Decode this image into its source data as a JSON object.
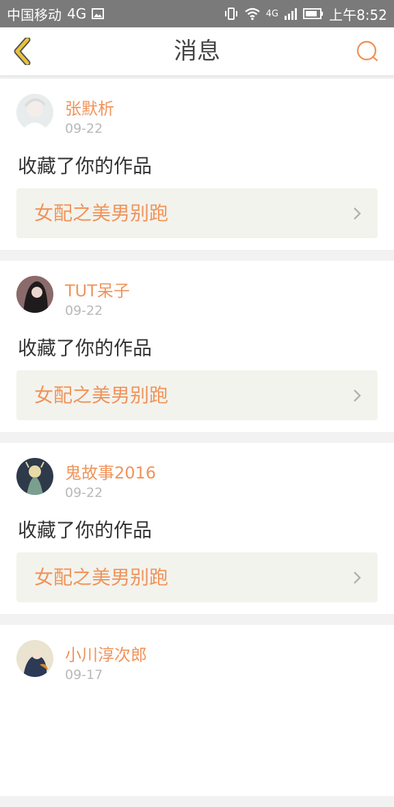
{
  "status_bar": {
    "carrier": "中国移动",
    "network": "4G",
    "network_small": "4G",
    "time": "上午8:52"
  },
  "header": {
    "title": "消息",
    "back_icon": "chevron-left-icon",
    "search_icon": "search-icon"
  },
  "colors": {
    "accent": "#f0935a",
    "back_icon": "#e8c33a",
    "card_bg": "#f3f3ed"
  },
  "messages": [
    {
      "user": "张默析",
      "date": "09-22",
      "action": "收藏了你的作品",
      "work": "女配之美男别跑"
    },
    {
      "user": "TUT呆子",
      "date": "09-22",
      "action": "收藏了你的作品",
      "work": "女配之美男别跑"
    },
    {
      "user": "鬼故事2016",
      "date": "09-22",
      "action": "收藏了你的作品",
      "work": "女配之美男别跑"
    },
    {
      "user": "小川淳次郎",
      "date": "09-17"
    }
  ]
}
